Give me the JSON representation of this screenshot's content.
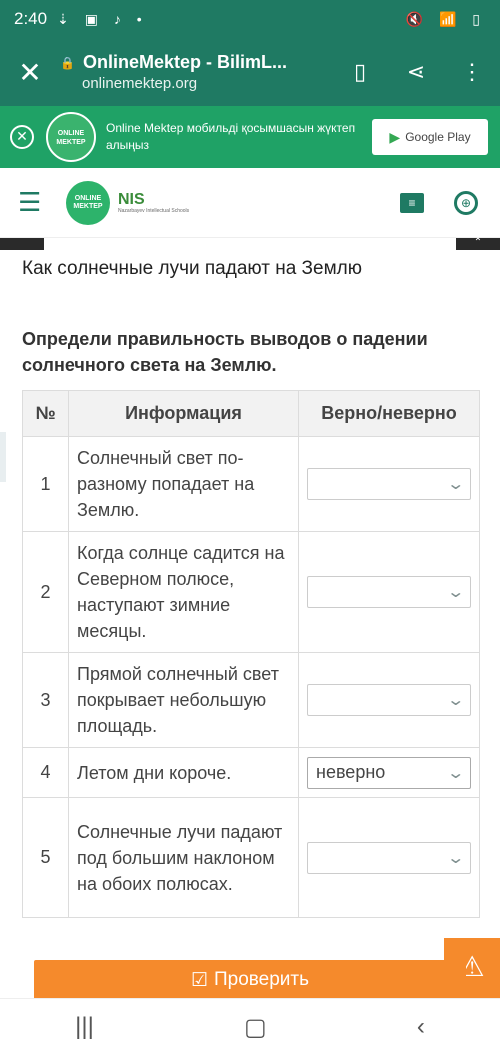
{
  "status": {
    "time": "2:40",
    "left_icons": "⇣ ▣ ♪ •",
    "right_icons": "🔇 📶 ▯"
  },
  "browser": {
    "title": "OnlineMektep - BilimL...",
    "host": "onlinemektep.org"
  },
  "promo": {
    "text": "Online Mektep мобильді қосымшасын жүктеп алыңыз",
    "logo_text": "ONLINE MEKTEP",
    "store_label": "Google Play"
  },
  "site": {
    "logo_text": "ONLINE MEKTEP",
    "nis_label": "NIS",
    "nis_sub": "Nazarbayev Intellectual Schools"
  },
  "page": {
    "title": "Как солнечные лучи падают на Землю",
    "task": "Определи правильность выводов о падении солнечного света на Землю."
  },
  "table": {
    "headers": [
      "№",
      "Информация",
      "Верно/неверно"
    ],
    "rows": [
      {
        "num": "1",
        "info": "Солнечный свет по-разному попадает на Землю.",
        "answer": ""
      },
      {
        "num": "2",
        "info": "Когда солнце садится на Северном полюсе, наступают зимние месяцы.",
        "answer": ""
      },
      {
        "num": "3",
        "info": "Прямой солнечный свет покрывает небольшую площадь.",
        "answer": ""
      },
      {
        "num": "4",
        "info": "Летом дни короче.",
        "answer": "неверно"
      },
      {
        "num": "5",
        "info": "Солнечные лучи падают под большим наклоном на обоих полюсах.",
        "answer": ""
      }
    ]
  },
  "actions": {
    "check_label": "Проверить"
  },
  "colors": {
    "brand": "#1f7a63",
    "promo": "#1fa266",
    "accent": "#f58a2c"
  }
}
